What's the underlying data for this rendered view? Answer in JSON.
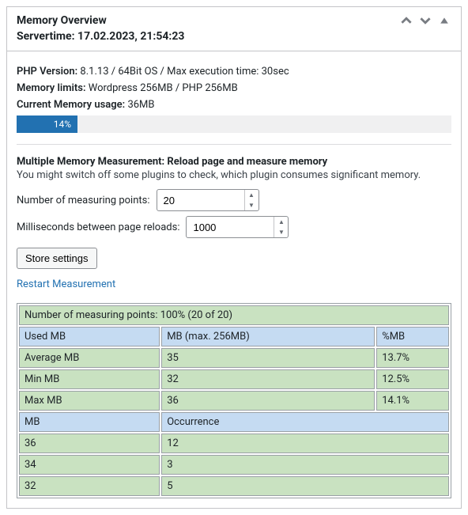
{
  "header": {
    "title": "Memory Overview",
    "servertime_label": "Servertime:",
    "servertime_value": "17.02.2023, 21:54:23"
  },
  "info": {
    "php_label": "PHP Version:",
    "php_value": "8.1.13 / 64Bit OS / Max execution time: 30sec",
    "mem_limits_label": "Memory limits:",
    "mem_limits_value": "Wordpress 256MB / PHP 256MB",
    "current_label": "Current Memory usage:",
    "current_value": "36MB",
    "progress_percent": "14%",
    "progress_width": "14%"
  },
  "measurement": {
    "heading": "Multiple Memory Measurement: Reload page and measure memory",
    "hint": "You might switch off some plugins to check, which plugin consumes significant memory.",
    "points_label": "Number of measuring points:",
    "points_value": "20",
    "ms_label": "Milliseconds between page reloads:",
    "ms_value": "1000",
    "store_btn": "Store settings",
    "restart_link": "Restart Measurement"
  },
  "table": {
    "summary": "Number of measuring points: 100% (20 of 20)",
    "head1": [
      "Used MB",
      "MB (max. 256MB)",
      "%MB"
    ],
    "rows1": [
      [
        "Average MB",
        "35",
        "13.7%"
      ],
      [
        "Min MB",
        "32",
        "12.5%"
      ],
      [
        "Max MB",
        "36",
        "14.1%"
      ]
    ],
    "head2": [
      "MB",
      "Occurrence"
    ],
    "rows2": [
      [
        "36",
        "12"
      ],
      [
        "34",
        "3"
      ],
      [
        "32",
        "5"
      ]
    ]
  }
}
